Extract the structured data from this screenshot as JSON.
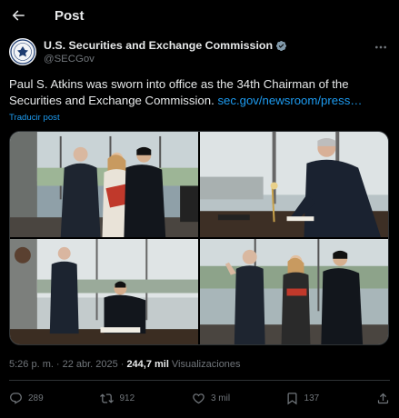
{
  "header": {
    "title": "Post"
  },
  "author": {
    "name": "U.S. Securities and Exchange Commission",
    "handle": "@SECGov"
  },
  "post": {
    "text": "Paul S. Atkins was sworn into office as the 34th Chairman of the Securities and Exchange Commission. ",
    "link": "sec.gov/newsroom/press…",
    "translate": "Traducir post"
  },
  "meta": {
    "time": "5:26 p. m.",
    "separator": "·",
    "date": "22 abr. 2025",
    "views": "244,7 mil",
    "views_label": "Visualizaciones"
  },
  "actions": {
    "replies": "289",
    "reposts": "912",
    "likes": "3 mil",
    "bookmarks": "137"
  },
  "icons": [
    "back-arrow-icon",
    "verified-badge-icon",
    "more-options-icon",
    "reply-icon",
    "repost-icon",
    "like-icon",
    "bookmark-icon",
    "share-icon"
  ],
  "colors": {
    "accent": "#1d9bf0",
    "secondary_text": "#71767b",
    "background": "#000000"
  }
}
